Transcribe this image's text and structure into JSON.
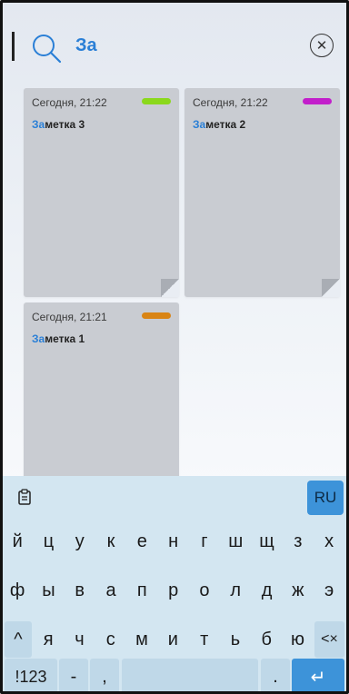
{
  "search": {
    "query": "За"
  },
  "notes": [
    {
      "date": "Сегодня, 21:22",
      "title_match": "За",
      "title_rest": "метка 3",
      "color": "#8bd81c"
    },
    {
      "date": "Сегодня, 21:22",
      "title_match": "За",
      "title_rest": "метка 2",
      "color": "#c21ecb"
    },
    {
      "date": "Сегодня, 21:21",
      "title_match": "За",
      "title_rest": "метка 1",
      "color": "#d98414"
    }
  ],
  "keyboard": {
    "lang_label": "RU",
    "row1": [
      "й",
      "ц",
      "у",
      "к",
      "е",
      "н",
      "г",
      "ш",
      "щ",
      "з",
      "х"
    ],
    "row2": [
      "ф",
      "ы",
      "в",
      "а",
      "п",
      "р",
      "о",
      "л",
      "д",
      "ж",
      "э"
    ],
    "row3": [
      "я",
      "ч",
      "с",
      "м",
      "и",
      "т",
      "ь",
      "б",
      "ю"
    ],
    "shift_label": "^",
    "backspace_label": "<×",
    "num_label": "!123",
    "dash_label": "-",
    "comma_label": ",",
    "dot_label": ".",
    "enter_label": "↵"
  },
  "colors": {
    "accent": "#3d93d9",
    "highlight": "#2a7fd6",
    "note_bg": "#c9ccd2",
    "keyboard_bg": "#d3e6f1"
  }
}
